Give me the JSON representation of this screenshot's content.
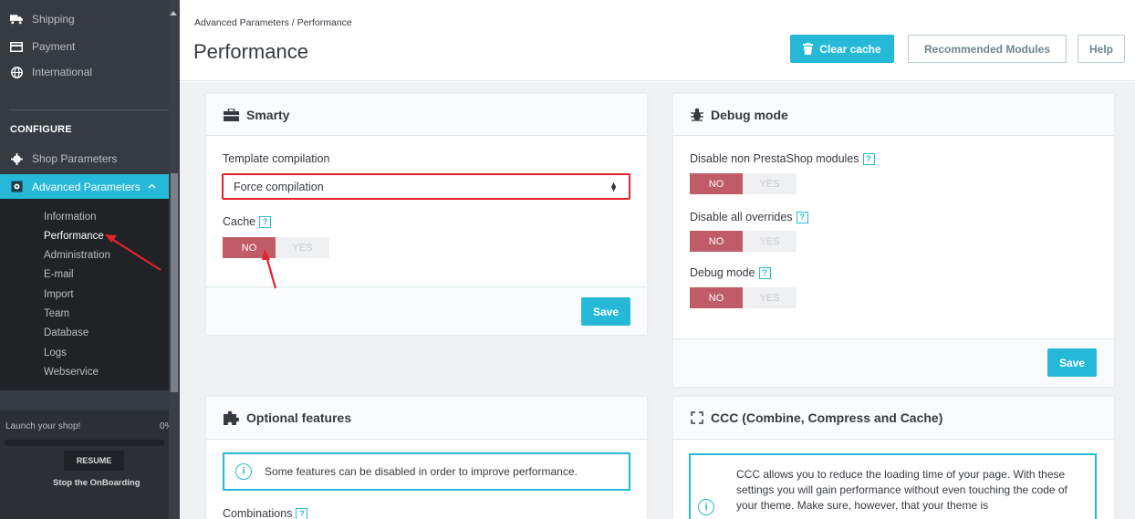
{
  "sidebar": {
    "top_items": [
      {
        "label": "Shipping",
        "icon": "truck-icon"
      },
      {
        "label": "Payment",
        "icon": "credit-card-icon"
      },
      {
        "label": "International",
        "icon": "globe-icon"
      }
    ],
    "section_label": "CONFIGURE",
    "configure_items": [
      {
        "label": "Shop Parameters",
        "icon": "gear-icon"
      },
      {
        "label": "Advanced Parameters",
        "icon": "settings-box-icon"
      }
    ],
    "sub_items": [
      "Information",
      "Performance",
      "Administration",
      "E-mail",
      "Import",
      "Team",
      "Database",
      "Logs",
      "Webservice"
    ],
    "onboarding": {
      "title": "Launch your shop!",
      "percent": "0%",
      "progress": 0,
      "resume_label": "RESUME",
      "stop_label": "Stop the OnBoarding"
    }
  },
  "header": {
    "breadcrumb": "Advanced Parameters  /  Performance",
    "title": "Performance",
    "clear_cache": "Clear cache",
    "recommended": "Recommended Modules",
    "help": "Help"
  },
  "smarty": {
    "title": "Smarty",
    "template_label": "Template compilation",
    "template_value": "Force compilation",
    "cache_label": "Cache",
    "toggle_no": "NO",
    "toggle_yes": "YES",
    "save": "Save"
  },
  "debug": {
    "title": "Debug mode",
    "rows": [
      {
        "label": "Disable non PrestaShop modules"
      },
      {
        "label": "Disable all overrides"
      },
      {
        "label": "Debug mode"
      }
    ],
    "toggle_no": "NO",
    "toggle_yes": "YES",
    "save": "Save"
  },
  "optional": {
    "title": "Optional features",
    "info": "Some features can be disabled in order to improve performance.",
    "combinations_label": "Combinations"
  },
  "ccc": {
    "title": "CCC (Combine, Compress and Cache)",
    "info": "CCC allows you to reduce the loading time of your page. With these settings you will gain performance without even touching the code of your theme. Make sure, however, that your theme is"
  },
  "help_mark": "?",
  "info_mark": "i",
  "colors": {
    "accent": "#25b9d7",
    "danger": "#c05c67",
    "highlight": "#e3222c"
  }
}
